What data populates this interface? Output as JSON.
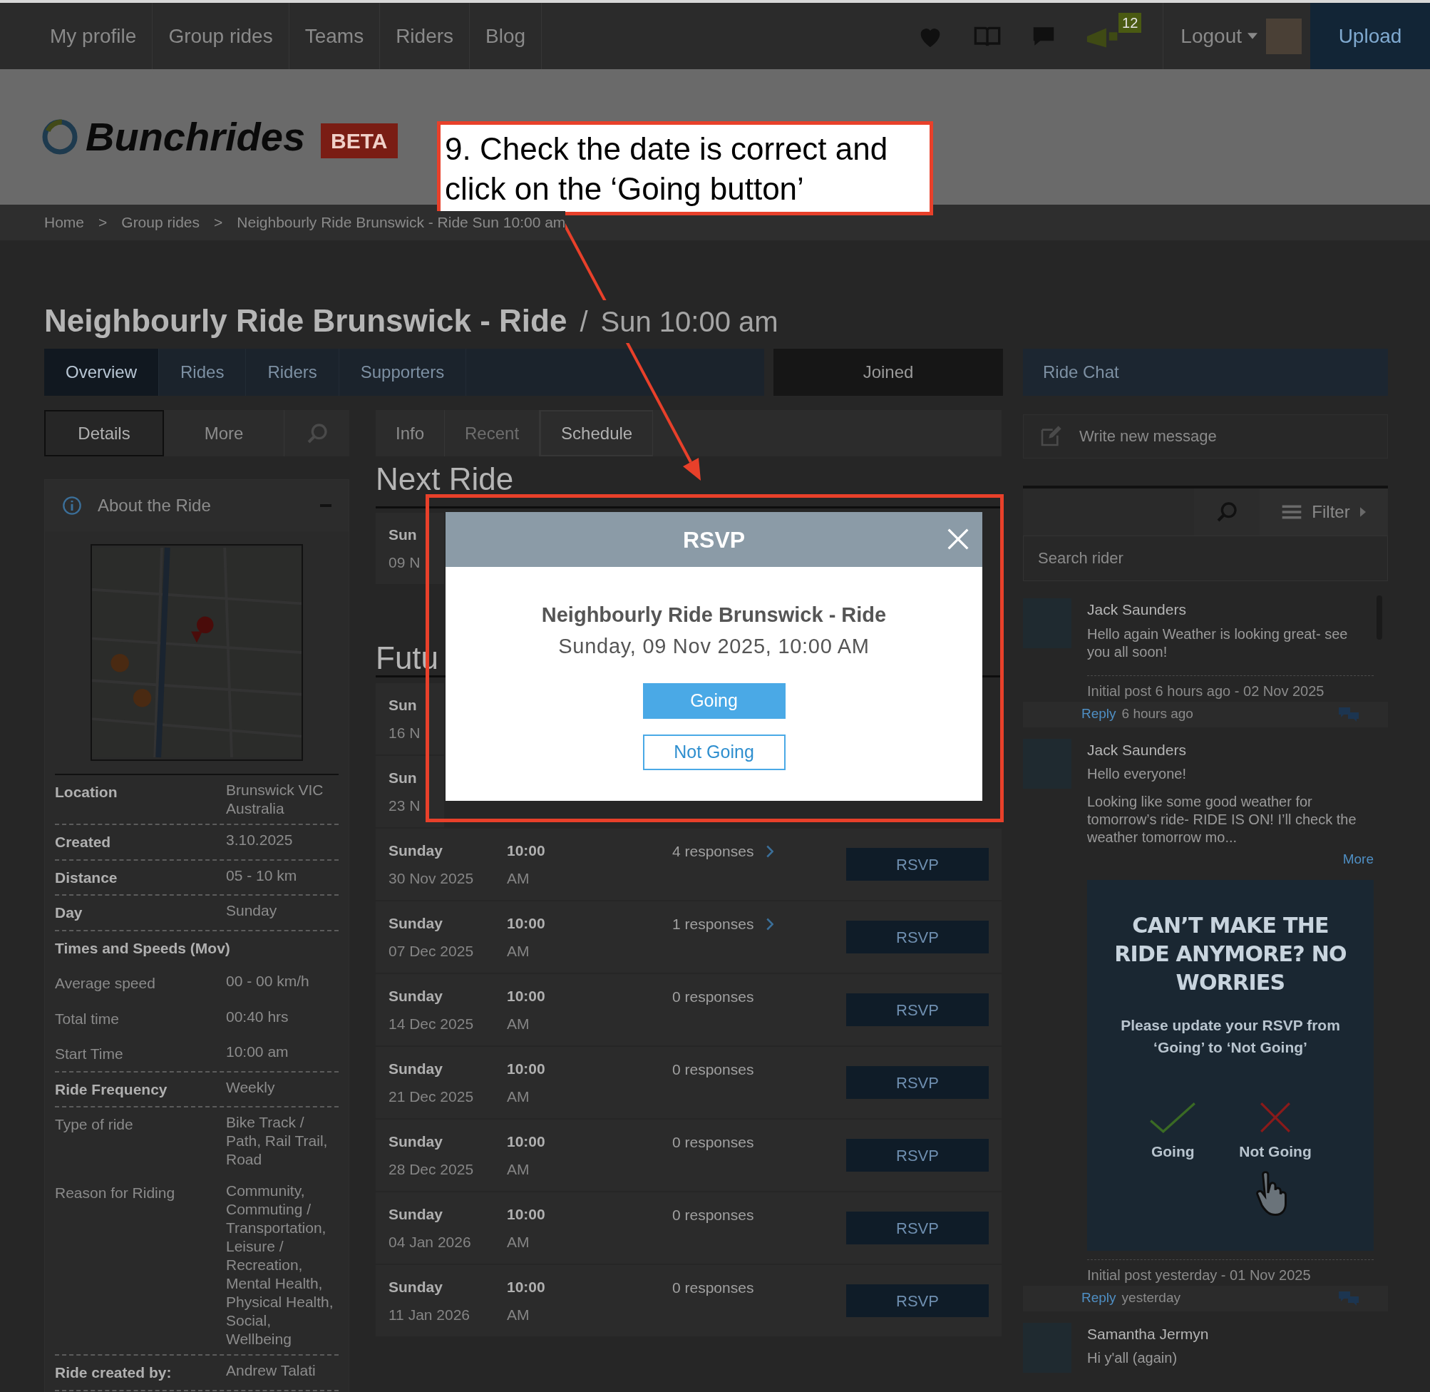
{
  "nav": {
    "items": [
      "My profile",
      "Group rides",
      "Teams",
      "Riders",
      "Blog"
    ],
    "badge": "12",
    "logout": "Logout",
    "upload": "Upload"
  },
  "brand": {
    "name": "Bunchrides",
    "tag": "BETA"
  },
  "breadcrumb": {
    "separator": ">",
    "items": [
      "Home",
      "Group rides",
      "Neighbourly Ride Brunswick - Ride Sun 10:00 am"
    ]
  },
  "title": {
    "name": "Neighbourly Ride Brunswick - Ride",
    "slash": "/",
    "time": "Sun 10:00 am"
  },
  "tabs": [
    {
      "label": "Overview",
      "selected": true
    },
    {
      "label": "Rides",
      "selected": false
    },
    {
      "label": "Riders",
      "selected": false
    },
    {
      "label": "Supporters",
      "selected": false
    }
  ],
  "joined": "Joined",
  "chat_title": "Ride Chat",
  "side_tabs": [
    {
      "label": "Details",
      "selected": true
    },
    {
      "label": "More",
      "selected": false
    }
  ],
  "view_tabs": [
    {
      "label": "Info",
      "selected": false,
      "disabled": false
    },
    {
      "label": "Recent",
      "selected": false,
      "disabled": true
    },
    {
      "label": "Schedule",
      "selected": true,
      "disabled": false
    }
  ],
  "about": {
    "title": "About the Ride",
    "details": [
      {
        "kind": "pair",
        "label": "Location",
        "value": "Brunswick VIC Australia",
        "strong": true,
        "divider": true
      },
      {
        "kind": "pair",
        "label": "Created",
        "value": "3.10.2025",
        "strong": true,
        "divider": true
      },
      {
        "kind": "pair",
        "label": "Distance",
        "value": "05 - 10 km",
        "strong": true,
        "divider": true
      },
      {
        "kind": "pair",
        "label": "Day",
        "value": "Sunday",
        "strong": true,
        "divider": true
      },
      {
        "kind": "heading",
        "label": "Times and Speeds (Mov)",
        "divider": false
      },
      {
        "kind": "pair",
        "label": "Average speed",
        "value": "00 - 00 km/h",
        "strong": false,
        "divider": false
      },
      {
        "kind": "pair",
        "label": "Total time",
        "value": "00:40 hrs",
        "strong": false,
        "divider": false
      },
      {
        "kind": "pair",
        "label": "Start Time",
        "value": "10:00 am",
        "strong": false,
        "divider": true
      },
      {
        "kind": "pair",
        "label": "Ride Frequency",
        "value": "Weekly",
        "strong": true,
        "divider": true
      },
      {
        "kind": "pair",
        "label": "Type of ride",
        "value": "Bike Track / Path, Rail Trail, Road",
        "strong": false,
        "divider": false
      },
      {
        "kind": "pair",
        "label": "Reason for Riding",
        "value": "Community, Commuting / Transportation, Leisure / Recreation, Mental Health, Physical Health, Social, Wellbeing",
        "strong": false,
        "divider": true
      },
      {
        "kind": "pair",
        "label": "Ride created by:",
        "value": "Andrew Talati",
        "strong": true,
        "divider": true
      }
    ]
  },
  "next_ride": {
    "heading": "Next Ride",
    "rows": [
      {
        "day": "Sun",
        "date": "09 N"
      }
    ]
  },
  "future": {
    "heading": "Futu",
    "rows": [
      {
        "kind": "covered",
        "day": "Sun",
        "date": "16 N"
      },
      {
        "kind": "covered",
        "day": "Sun",
        "date": "23 N"
      },
      {
        "kind": "full",
        "day": "Sunday",
        "date": "30 Nov 2025",
        "time": "10:00",
        "ampm": "AM",
        "responses": "4 responses",
        "link": true,
        "button": "RSVP"
      },
      {
        "kind": "full",
        "day": "Sunday",
        "date": "07 Dec 2025",
        "time": "10:00",
        "ampm": "AM",
        "responses": "1 responses",
        "link": true,
        "button": "RSVP"
      },
      {
        "kind": "full",
        "day": "Sunday",
        "date": "14 Dec 2025",
        "time": "10:00",
        "ampm": "AM",
        "responses": "0 responses",
        "link": false,
        "button": "RSVP"
      },
      {
        "kind": "full",
        "day": "Sunday",
        "date": "21 Dec 2025",
        "time": "10:00",
        "ampm": "AM",
        "responses": "0 responses",
        "link": false,
        "button": "RSVP"
      },
      {
        "kind": "full",
        "day": "Sunday",
        "date": "28 Dec 2025",
        "time": "10:00",
        "ampm": "AM",
        "responses": "0 responses",
        "link": false,
        "button": "RSVP"
      },
      {
        "kind": "full",
        "day": "Sunday",
        "date": "04 Jan 2026",
        "time": "10:00",
        "ampm": "AM",
        "responses": "0 responses",
        "link": false,
        "button": "RSVP"
      },
      {
        "kind": "full",
        "day": "Sunday",
        "date": "11 Jan 2026",
        "time": "10:00",
        "ampm": "AM",
        "responses": "0 responses",
        "link": false,
        "button": "RSVP"
      }
    ]
  },
  "chat": {
    "compose_placeholder": "Write new message",
    "filter": "Filter",
    "search_placeholder": "Search rider",
    "messages": [
      {
        "author": "Jack Saunders",
        "paragraphs": [
          "Hello again Weather is looking great- see you all soon!"
        ],
        "footer": "Initial post 6 hours ago - 02 Nov 2025",
        "reply": "Reply",
        "ago": "6 hours ago"
      },
      {
        "author": "Jack Saunders",
        "paragraphs": [
          "Hello everyone!",
          "Looking like some good weather for tomorrow’s ride- RIDE IS ON! I’ll check the weather tomorrow mo..."
        ],
        "more": "More",
        "promo": {
          "headline": "CAN’T MAKE THE RIDE ANYMORE? NO WORRIES",
          "body": "Please update your RSVP from ‘Going’ to ‘Not Going’",
          "going": "Going",
          "not_going": "Not Going"
        },
        "footer": "Initial post yesterday - 01 Nov 2025",
        "reply": "Reply",
        "ago": "yesterday"
      },
      {
        "author": "Samantha Jermyn",
        "paragraphs": [
          "Hi y'all (again)"
        ]
      }
    ]
  },
  "modal": {
    "title": "RSVP",
    "ride": "Neighbourly Ride Brunswick - Ride",
    "date": "Sunday, 09 Nov 2025, 10:00 AM",
    "buttons": [
      {
        "label": "Going",
        "kind": "primary"
      },
      {
        "label": "Not Going",
        "kind": "outline"
      }
    ]
  },
  "annotation": {
    "text": "9. Check the date is correct and click on the ‘Going button’"
  }
}
